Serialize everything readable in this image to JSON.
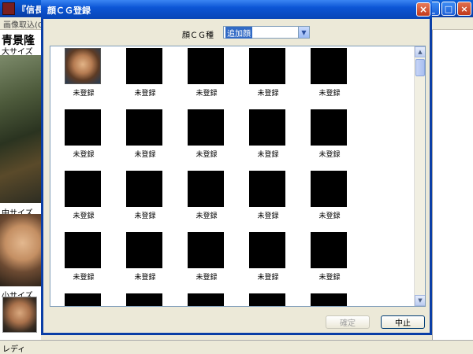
{
  "main_window": {
    "title": "『信長の",
    "menu": "画像取込(C",
    "officer_name": "青景隆",
    "size_large": "大サイズ",
    "size_medium": "中サイズ",
    "size_small": "小サイズ",
    "controls": {
      "minimize": "_",
      "maximize": "□",
      "close": "×"
    }
  },
  "statusbar": {
    "text": "レディ"
  },
  "dialog": {
    "title": "顔ＣＧ登録",
    "close": "×",
    "type_label": "顔ＣＧ種",
    "type_value": "追加顔",
    "type_arrow": "▼",
    "confirm_label": "確定",
    "cancel_label": "中止",
    "scroll_up": "▲",
    "scroll_down": "▼",
    "cells": [
      {
        "label": "未登録",
        "has_image": true
      },
      {
        "label": "未登録",
        "has_image": false
      },
      {
        "label": "未登録",
        "has_image": false
      },
      {
        "label": "未登録",
        "has_image": false
      },
      {
        "label": "未登録",
        "has_image": false
      },
      {
        "label": "未登録",
        "has_image": false
      },
      {
        "label": "未登録",
        "has_image": false
      },
      {
        "label": "未登録",
        "has_image": false
      },
      {
        "label": "未登録",
        "has_image": false
      },
      {
        "label": "未登録",
        "has_image": false
      },
      {
        "label": "未登録",
        "has_image": false
      },
      {
        "label": "未登録",
        "has_image": false
      },
      {
        "label": "未登録",
        "has_image": false
      },
      {
        "label": "未登録",
        "has_image": false
      },
      {
        "label": "未登録",
        "has_image": false
      },
      {
        "label": "未登録",
        "has_image": false
      },
      {
        "label": "未登録",
        "has_image": false
      },
      {
        "label": "未登録",
        "has_image": false
      },
      {
        "label": "未登録",
        "has_image": false
      },
      {
        "label": "未登録",
        "has_image": false
      },
      {
        "label": "",
        "has_image": false
      },
      {
        "label": "",
        "has_image": false
      },
      {
        "label": "",
        "has_image": false
      },
      {
        "label": "",
        "has_image": false
      },
      {
        "label": "",
        "has_image": false
      }
    ]
  }
}
